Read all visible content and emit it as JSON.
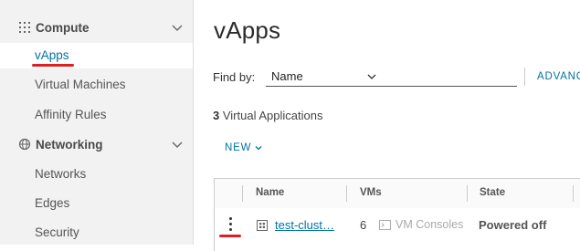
{
  "sidebar": {
    "sections": [
      {
        "label": "Compute",
        "icon": "compute-grid-icon"
      },
      {
        "label": "Networking",
        "icon": "networking-globe-icon"
      }
    ],
    "compute_items": [
      {
        "label": "vApps",
        "active": true
      },
      {
        "label": "Virtual Machines",
        "active": false
      },
      {
        "label": "Affinity Rules",
        "active": false
      }
    ],
    "networking_items": [
      {
        "label": "Networks"
      },
      {
        "label": "Edges"
      },
      {
        "label": "Security"
      }
    ]
  },
  "main": {
    "title": "vApps",
    "find_by": {
      "label": "Find by:",
      "value": "Name"
    },
    "advanced_label": "ADVANC",
    "count": {
      "number": "3",
      "text": " Virtual Applications"
    },
    "new_button": "NEW",
    "grid": {
      "headers": [
        "Name",
        "VMs",
        "State"
      ],
      "rows": [
        {
          "name": "test-clust…",
          "vms": "6",
          "console": "VM Consoles",
          "state": "Powered off"
        }
      ]
    }
  },
  "colors": {
    "accent": "#0072a3",
    "annotation": "#e02020",
    "sidebar_bg": "#f2f2f2"
  }
}
